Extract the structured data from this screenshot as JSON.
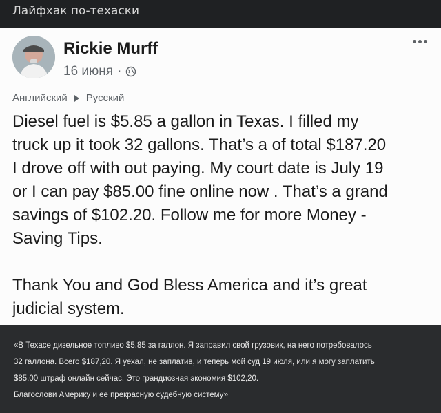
{
  "header": {
    "title": "Лайфхак по-техаски"
  },
  "post": {
    "author": "Rickie Murff",
    "date": "16 июня",
    "separator": "·",
    "privacy_icon": "globe-icon",
    "translation": {
      "from": "Английский",
      "to": "Русский"
    },
    "lines": [
      "Diesel fuel is $5.85 a gallon in Texas. I filled my",
      "truck up it took 32 gallons. That’s a of total $187.20",
      "I drove off with out paying. My court date is July 19",
      "or I can pay $85.00 fine online now . That’s a grand",
      "savings of $102.20.  Follow me for more Money -",
      "Saving Tips.",
      "",
      "Thank You and God Bless America and it’s great",
      "judicial system."
    ]
  },
  "caption": {
    "lines": [
      "«В Техасе дизельное топливо $5.85 за галлон. Я заправил свой грузовик, на него потребовалось",
      "32 галлона. Всего $187,20. Я уехал, не заплатив, и теперь мой суд 19 июля, или я могу заплатить",
      "$85.00 штраф онлайн сейчас. Это грандиозная экономия $102,20.",
      "Благослови Америку и ее прекрасную судебную систему»"
    ]
  }
}
